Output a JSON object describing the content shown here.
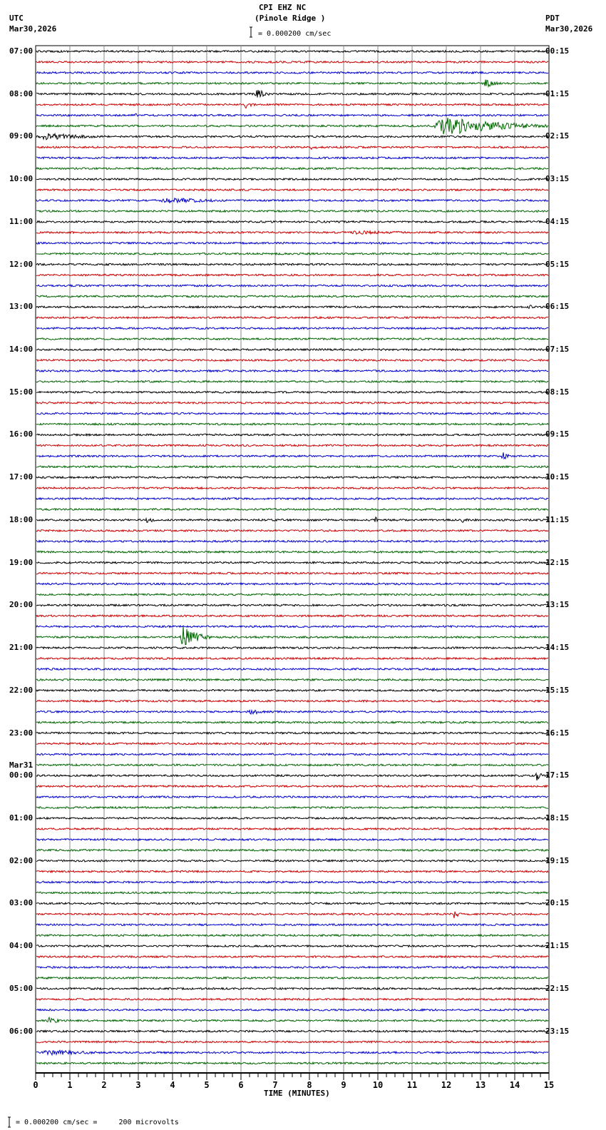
{
  "header": {
    "title": "CPI EHZ NC",
    "subtitle": "(Pinole Ridge )",
    "left_tz": "UTC",
    "left_date": "Mar30,2026",
    "right_tz": "PDT",
    "right_date": "Mar30,2026",
    "scale_text": "= 0.000200 cm/sec"
  },
  "footer": {
    "scale_text": "= 0.000200 cm/sec =     200 microvolts"
  },
  "chart_data": {
    "type": "line",
    "title": "CPI EHZ NC (Pinole Ridge )",
    "xlabel": "TIME (MINUTES)",
    "xlim": [
      0,
      15
    ],
    "x_ticks": [
      "0",
      "1",
      "2",
      "3",
      "4",
      "5",
      "6",
      "7",
      "8",
      "9",
      "10",
      "11",
      "12",
      "13",
      "14",
      "15"
    ],
    "grid": true,
    "trace_colors": [
      "#000000",
      "#cc0000",
      "#0000cc",
      "#006600"
    ],
    "traces_per_hour": 4,
    "minutes_per_trace": 15,
    "left_labels": [
      "07:00",
      "08:00",
      "09:00",
      "10:00",
      "11:00",
      "12:00",
      "13:00",
      "14:00",
      "15:00",
      "16:00",
      "17:00",
      "18:00",
      "19:00",
      "20:00",
      "21:00",
      "22:00",
      "23:00",
      "00:00",
      "01:00",
      "02:00",
      "03:00",
      "04:00",
      "05:00",
      "06:00"
    ],
    "date_change_label": "Mar31",
    "right_labels": [
      "00:15",
      "01:15",
      "02:15",
      "03:15",
      "04:15",
      "05:15",
      "06:15",
      "07:15",
      "08:15",
      "09:15",
      "10:15",
      "11:15",
      "12:15",
      "13:15",
      "14:15",
      "15:15",
      "16:15",
      "17:15",
      "18:15",
      "19:15",
      "20:15",
      "21:15",
      "22:15",
      "23:15"
    ],
    "events": [
      {
        "trace": 3,
        "minute": 13.1,
        "amplitude": 8,
        "duration": 0.5
      },
      {
        "trace": 4,
        "minute": 6.4,
        "amplitude": 9,
        "duration": 0.5
      },
      {
        "trace": 5,
        "minute": 6.1,
        "amplitude": 6,
        "duration": 0.4
      },
      {
        "trace": 6,
        "minute": 2.9,
        "amplitude": 3,
        "duration": 0.2
      },
      {
        "trace": 7,
        "minute": 11.6,
        "amplitude": 14,
        "duration": 3.4
      },
      {
        "trace": 8,
        "minute": 0.0,
        "amplitude": 5,
        "duration": 3.0
      },
      {
        "trace": 9,
        "minute": 8.0,
        "amplitude": 3,
        "duration": 0.6
      },
      {
        "trace": 14,
        "minute": 3.5,
        "amplitude": 4,
        "duration": 3.5
      },
      {
        "trace": 17,
        "minute": 9.0,
        "amplitude": 3,
        "duration": 4.0
      },
      {
        "trace": 24,
        "minute": 14.4,
        "amplitude": 4,
        "duration": 0.3
      },
      {
        "trace": 38,
        "minute": 13.6,
        "amplitude": 6,
        "duration": 0.4
      },
      {
        "trace": 44,
        "minute": 3.2,
        "amplitude": 5,
        "duration": 0.5
      },
      {
        "trace": 44,
        "minute": 9.9,
        "amplitude": 5,
        "duration": 0.2
      },
      {
        "trace": 44,
        "minute": 12.4,
        "amplitude": 4,
        "duration": 0.6
      },
      {
        "trace": 55,
        "minute": 4.2,
        "amplitude": 16,
        "duration": 0.9
      },
      {
        "trace": 62,
        "minute": 6.2,
        "amplitude": 4,
        "duration": 1.0
      },
      {
        "trace": 68,
        "minute": 14.6,
        "amplitude": 8,
        "duration": 0.3
      },
      {
        "trace": 81,
        "minute": 12.2,
        "amplitude": 7,
        "duration": 0.3
      },
      {
        "trace": 91,
        "minute": 0.3,
        "amplitude": 5,
        "duration": 0.8
      },
      {
        "trace": 94,
        "minute": 0.0,
        "amplitude": 4,
        "duration": 3.5
      }
    ]
  }
}
